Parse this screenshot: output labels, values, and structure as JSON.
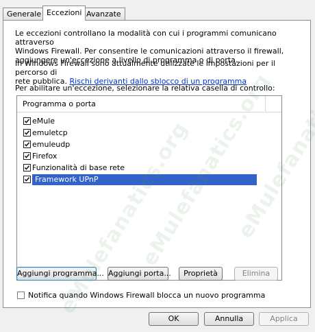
{
  "tabs": [
    {
      "label": "Generale",
      "active": false
    },
    {
      "label": "Eccezioni",
      "active": true
    },
    {
      "label": "Avanzate",
      "active": false
    }
  ],
  "description": {
    "paragraph1_line1": "Le eccezioni controllano la modalità con cui i programmi comunicano attraverso",
    "paragraph1_line2": "Windows Firewall. Per consentire le comunicazioni attraverso il firewall,",
    "paragraph1_line3": "aggiungere un'eccezione a livello di programma o di porta.",
    "paragraph2_line1": "In Windows Firewall sono attualmente utilizzate le impostazioni per il percorso di",
    "paragraph2_line2": "rete pubblica.",
    "risk_link": "Rischi derivanti dallo sblocco di un programma",
    "instruction": "Per abilitare un'eccezione, selezionare la relativa casella di controllo:"
  },
  "list": {
    "header": "Programma o porta",
    "items": [
      {
        "label": "eMule",
        "checked": true
      },
      {
        "label": "emuletcp",
        "checked": true
      },
      {
        "label": "emuleudp",
        "checked": true
      },
      {
        "label": "Firefox",
        "checked": true
      },
      {
        "label": "Funzionalità di base rete",
        "checked": true
      },
      {
        "label": "Framework UPnP",
        "checked": true,
        "selected": true
      }
    ]
  },
  "actions": {
    "add_program": "Aggiungi programma...",
    "add_port": "Aggiungi porta...",
    "properties": "Proprietà",
    "delete": "Elimina"
  },
  "notify": {
    "label": "Notifica quando Windows Firewall blocca un nuovo programma",
    "checked": false
  },
  "footer": {
    "ok": "OK",
    "cancel": "Annulla",
    "apply": "Applica"
  },
  "watermark": "eMulefanatics.org",
  "colors": {
    "selection": "#3363c9",
    "link": "#0033cc",
    "watermark": "#5a9a5a"
  }
}
